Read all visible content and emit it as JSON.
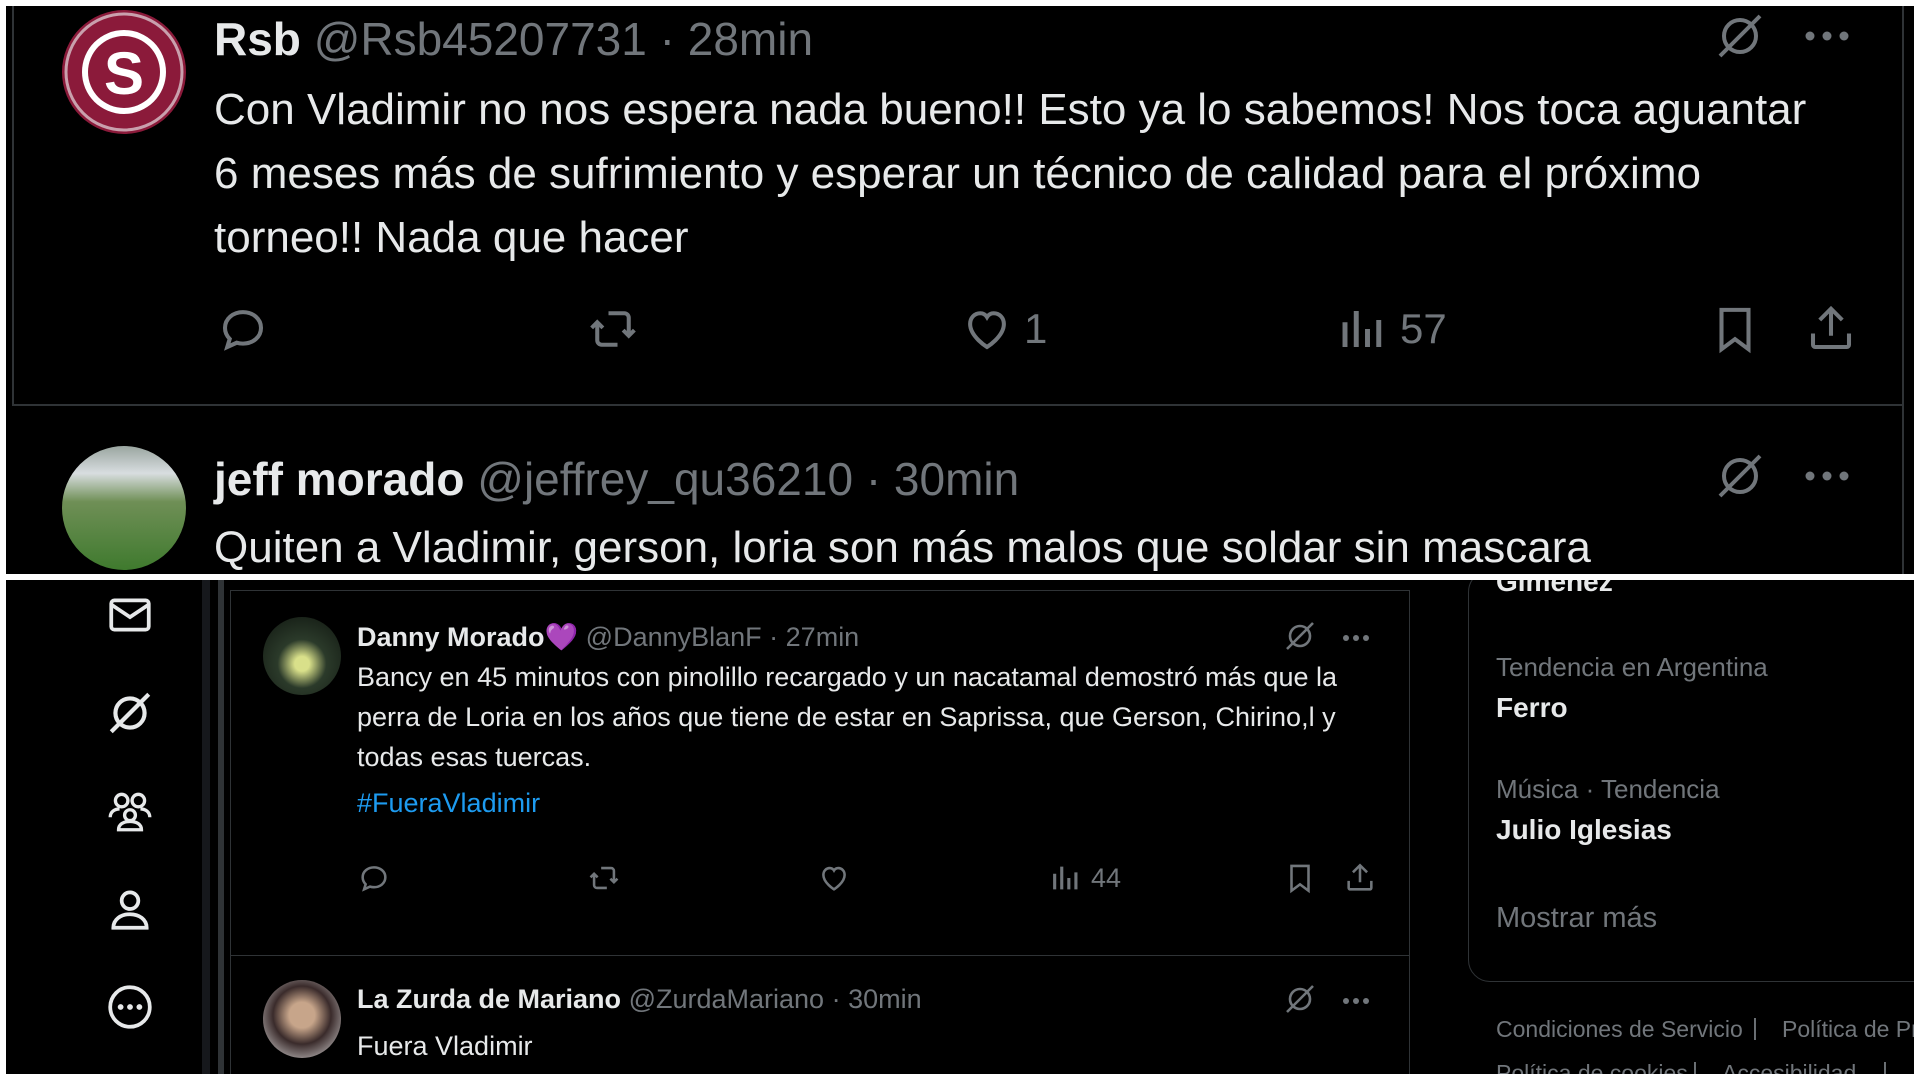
{
  "top": {
    "tweet1": {
      "name": "Rsb",
      "handle": "@Rsb45207731",
      "time": "· 28min",
      "text": "Con Vladimir no nos espera nada  bueno!! Esto ya lo sabemos! Nos toca aguantar 6 meses más de sufrimiento y esperar un técnico de calidad para el próximo torneo!! Nada que hacer",
      "reply_count": "",
      "repost_count": "",
      "like_count": "1",
      "view_count": "57",
      "avatar_letter": "S"
    },
    "tweet2": {
      "name": "jeff morado",
      "handle": "@jeffrey_qu36210",
      "time": "· 30min",
      "text": "Quiten a Vladimir, gerson, loria son más malos que soldar sin mascara"
    }
  },
  "bottom": {
    "nav_icons": [
      "mail-icon",
      "grok-icon",
      "communities-icon",
      "profile-icon",
      "more-circle-icon"
    ],
    "tweet1": {
      "name": "Danny Morado",
      "name_emoji": "💜",
      "handle": "@DannyBlanF",
      "time": "· 27min",
      "text": "Bancy en 45 minutos con pinolillo recargado y un nacatamal demostró más que la perra de Loria en los años que tiene de estar en Saprissa, que Gerson, Chirino,l y todas esas tuercas.",
      "hashtag": "#FueraVladimir",
      "view_count": "44"
    },
    "tweet2": {
      "name": "La Zurda de Mariano",
      "handle": "@ZurdaMariano",
      "time": "· 30min",
      "text": "Fuera Vladimir"
    },
    "sidebar": {
      "cut_trend": "Gimenez",
      "trends": [
        {
          "meta": "Tendencia en Argentina",
          "name": "Ferro"
        },
        {
          "meta": "Música · Tendencia",
          "name": "Julio Iglesias"
        }
      ],
      "show_more": "Mostrar más",
      "footer": [
        "Condiciones de Servicio",
        "|",
        "Política de Pri",
        "Política de cookies",
        "|",
        "Accesibilidad",
        "|"
      ]
    }
  },
  "colors": {
    "background": "#000000",
    "text": "#e7e9ea",
    "muted": "#71767b",
    "link": "#1d9bf0",
    "border": "#2f3336",
    "saprissa": "#8b1a3a"
  }
}
